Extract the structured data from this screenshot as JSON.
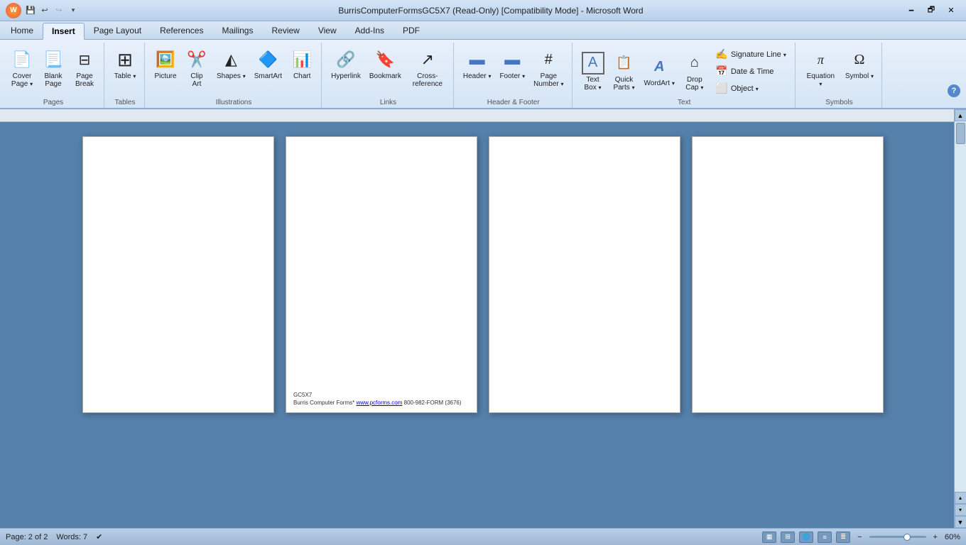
{
  "titlebar": {
    "title": "BurrisComputerFormsGC5X7 (Read-Only) [Compatibility Mode] - Microsoft Word",
    "minimize": "🗕",
    "restore": "🗗",
    "close": "✕"
  },
  "quick_access": {
    "save": "💾",
    "undo": "↩",
    "redo": "↪",
    "dropdown": "▾"
  },
  "tabs": [
    "Home",
    "Insert",
    "Page Layout",
    "References",
    "Mailings",
    "Review",
    "View",
    "Add-Ins",
    "PDF"
  ],
  "active_tab": "Insert",
  "ribbon_groups": {
    "pages": {
      "label": "Pages",
      "buttons": [
        "Cover Page",
        "Blank Page",
        "Page Break"
      ]
    },
    "tables": {
      "label": "Tables",
      "button": "Table"
    },
    "illustrations": {
      "label": "Illustrations",
      "buttons": [
        "Picture",
        "Clip Art",
        "Shapes",
        "SmartArt",
        "Chart"
      ]
    },
    "links": {
      "label": "Links",
      "buttons": [
        "Hyperlink",
        "Bookmark",
        "Cross-reference"
      ]
    },
    "header_footer": {
      "label": "Header & Footer",
      "buttons": [
        "Header",
        "Footer",
        "Page Number"
      ]
    },
    "text": {
      "label": "Text",
      "buttons": [
        "Text Box",
        "Quick Parts",
        "WordArt",
        "Drop Cap",
        "Signature Line",
        "Date & Time",
        "Object"
      ]
    },
    "symbols": {
      "label": "Symbols",
      "buttons": [
        "Equation",
        "Symbol"
      ]
    }
  },
  "page_footer": {
    "code": "GC5X7",
    "company": "Burris Computer Forms*",
    "url_text": "www.pcforms.com",
    "url": "www.pcforms.com",
    "phone": "800-982-FORM (3676)"
  },
  "statusbar": {
    "page": "Page: 2 of 2",
    "words": "Words: 7",
    "zoom": "60%"
  }
}
